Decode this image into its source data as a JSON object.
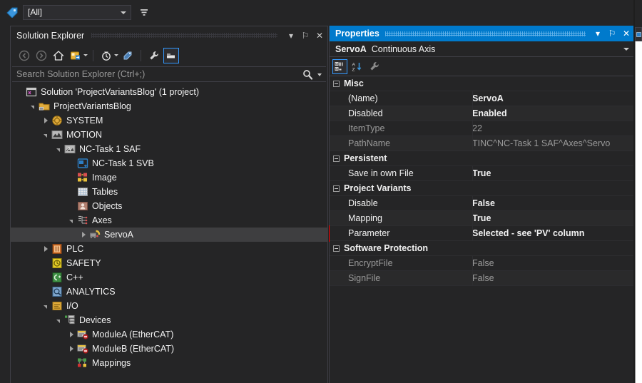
{
  "topbar": {
    "tag_icon": "tag-icon",
    "filter_value": "[All]",
    "filter_icon": "filter-icon"
  },
  "solution_explorer": {
    "title": "Solution Explorer",
    "window_buttons": [
      {
        "name": "dropdown-icon",
        "glyph": "▾"
      },
      {
        "name": "pin-icon",
        "glyph": "⚐"
      },
      {
        "name": "close-icon",
        "glyph": "✕"
      }
    ],
    "toolbar": [
      {
        "name": "back-icon",
        "title": "Back"
      },
      {
        "name": "forward-icon",
        "title": "Forward"
      },
      {
        "name": "home-icon",
        "title": "Home"
      },
      {
        "name": "sync-with-active-document-icon",
        "title": "Sync with Active Document"
      },
      {
        "name": "pending-changes-icon",
        "title": "Pending Changes Filter"
      },
      {
        "name": "refresh-icon",
        "title": "Refresh"
      },
      {
        "name": "properties-icon",
        "title": "Properties"
      },
      {
        "name": "show-all-files-icon",
        "title": "Show All Files"
      }
    ],
    "search": {
      "placeholder": "Search Solution Explorer (Ctrl+;)",
      "value": "",
      "search_icon": "magnifier-icon",
      "options_icon": "chevron-down-icon"
    },
    "tree": [
      {
        "depth": 0,
        "expander": "none",
        "icon": "solution-icon",
        "label": "Solution 'ProjectVariantsBlog' (1 project)",
        "selected": false
      },
      {
        "depth": 1,
        "expander": "expanded",
        "icon": "project-icon",
        "label": "ProjectVariantsBlog",
        "selected": false
      },
      {
        "depth": 2,
        "expander": "collapsed",
        "icon": "system-icon",
        "label": "SYSTEM",
        "selected": false
      },
      {
        "depth": 2,
        "expander": "expanded",
        "icon": "motion-icon",
        "label": "MOTION",
        "selected": false
      },
      {
        "depth": 3,
        "expander": "expanded",
        "icon": "nctask-icon",
        "label": "NC-Task 1 SAF",
        "selected": false
      },
      {
        "depth": 4,
        "expander": "none",
        "icon": "ncsvb-icon",
        "label": "NC-Task 1 SVB",
        "selected": false
      },
      {
        "depth": 4,
        "expander": "none",
        "icon": "image-icon",
        "label": "Image",
        "selected": false
      },
      {
        "depth": 4,
        "expander": "none",
        "icon": "tables-icon",
        "label": "Tables",
        "selected": false
      },
      {
        "depth": 4,
        "expander": "none",
        "icon": "objects-icon",
        "label": "Objects",
        "selected": false
      },
      {
        "depth": 4,
        "expander": "expanded",
        "icon": "axes-icon",
        "label": "Axes",
        "selected": false
      },
      {
        "depth": 5,
        "expander": "collapsed",
        "icon": "axis-icon",
        "label": "ServoA",
        "selected": true
      },
      {
        "depth": 2,
        "expander": "collapsed",
        "icon": "plc-icon",
        "label": "PLC",
        "selected": false
      },
      {
        "depth": 2,
        "expander": "none",
        "icon": "safety-icon",
        "label": "SAFETY",
        "selected": false
      },
      {
        "depth": 2,
        "expander": "none",
        "icon": "cpp-icon",
        "label": "C++",
        "selected": false
      },
      {
        "depth": 2,
        "expander": "none",
        "icon": "analytics-icon",
        "label": "ANALYTICS",
        "selected": false
      },
      {
        "depth": 2,
        "expander": "expanded",
        "icon": "io-icon",
        "label": "I/O",
        "selected": false
      },
      {
        "depth": 3,
        "expander": "expanded",
        "icon": "devices-icon",
        "label": "Devices",
        "selected": false
      },
      {
        "depth": 4,
        "expander": "collapsed",
        "icon": "ethercat-icon",
        "label": "ModuleA (EtherCAT)",
        "selected": false
      },
      {
        "depth": 4,
        "expander": "collapsed",
        "icon": "ethercat-icon",
        "label": "ModuleB (EtherCAT)",
        "selected": false
      },
      {
        "depth": 4,
        "expander": "none",
        "icon": "mappings-icon",
        "label": "Mappings",
        "selected": false
      }
    ]
  },
  "properties": {
    "title": "Properties",
    "window_buttons": [
      {
        "name": "dropdown-icon",
        "glyph": "▾"
      },
      {
        "name": "pin-icon",
        "glyph": "⚐"
      },
      {
        "name": "close-icon",
        "glyph": "✕"
      }
    ],
    "object_name": "ServoA",
    "object_type": "Continuous Axis",
    "toolbar": [
      {
        "name": "categorized-view-icon",
        "active": true
      },
      {
        "name": "alphabetical-sort-icon",
        "active": false
      },
      {
        "name": "property-pages-icon",
        "active": false
      }
    ],
    "rows": [
      {
        "kind": "category",
        "name": "Misc"
      },
      {
        "kind": "prop",
        "name": "(Name)",
        "value": "ServoA",
        "dim": false
      },
      {
        "kind": "prop",
        "name": "Disabled",
        "value": "Enabled",
        "dim": false
      },
      {
        "kind": "prop",
        "name": "ItemType",
        "value": "22",
        "dim": true
      },
      {
        "kind": "prop",
        "name": "PathName",
        "value": "TINC^NC-Task 1 SAF^Axes^Servo",
        "dim": true
      },
      {
        "kind": "category",
        "name": "Persistent"
      },
      {
        "kind": "prop",
        "name": "Save in own File",
        "value": "True",
        "dim": false
      },
      {
        "kind": "category",
        "name": "Project Variants"
      },
      {
        "kind": "prop",
        "name": "Disable",
        "value": "False",
        "dim": false
      },
      {
        "kind": "prop",
        "name": "Mapping",
        "value": "True",
        "dim": false
      },
      {
        "kind": "prop",
        "name": "Parameter",
        "value": "Selected - see 'PV' column",
        "dim": false,
        "highlight": true
      },
      {
        "kind": "category",
        "name": "Software Protection"
      },
      {
        "kind": "prop",
        "name": "EncryptFile",
        "value": "False",
        "dim": true
      },
      {
        "kind": "prop",
        "name": "SignFile",
        "value": "False",
        "dim": true
      }
    ],
    "highlight_color": "#ff0000"
  },
  "right_panel": {
    "tab_icon": "document-icon"
  },
  "theme": {
    "background": "#252526",
    "panel_border": "#3f3f46",
    "accent": "#007acc",
    "text": "#f1f1f1",
    "text_dim": "#9a9a9a",
    "selection": "#3e3e40"
  }
}
